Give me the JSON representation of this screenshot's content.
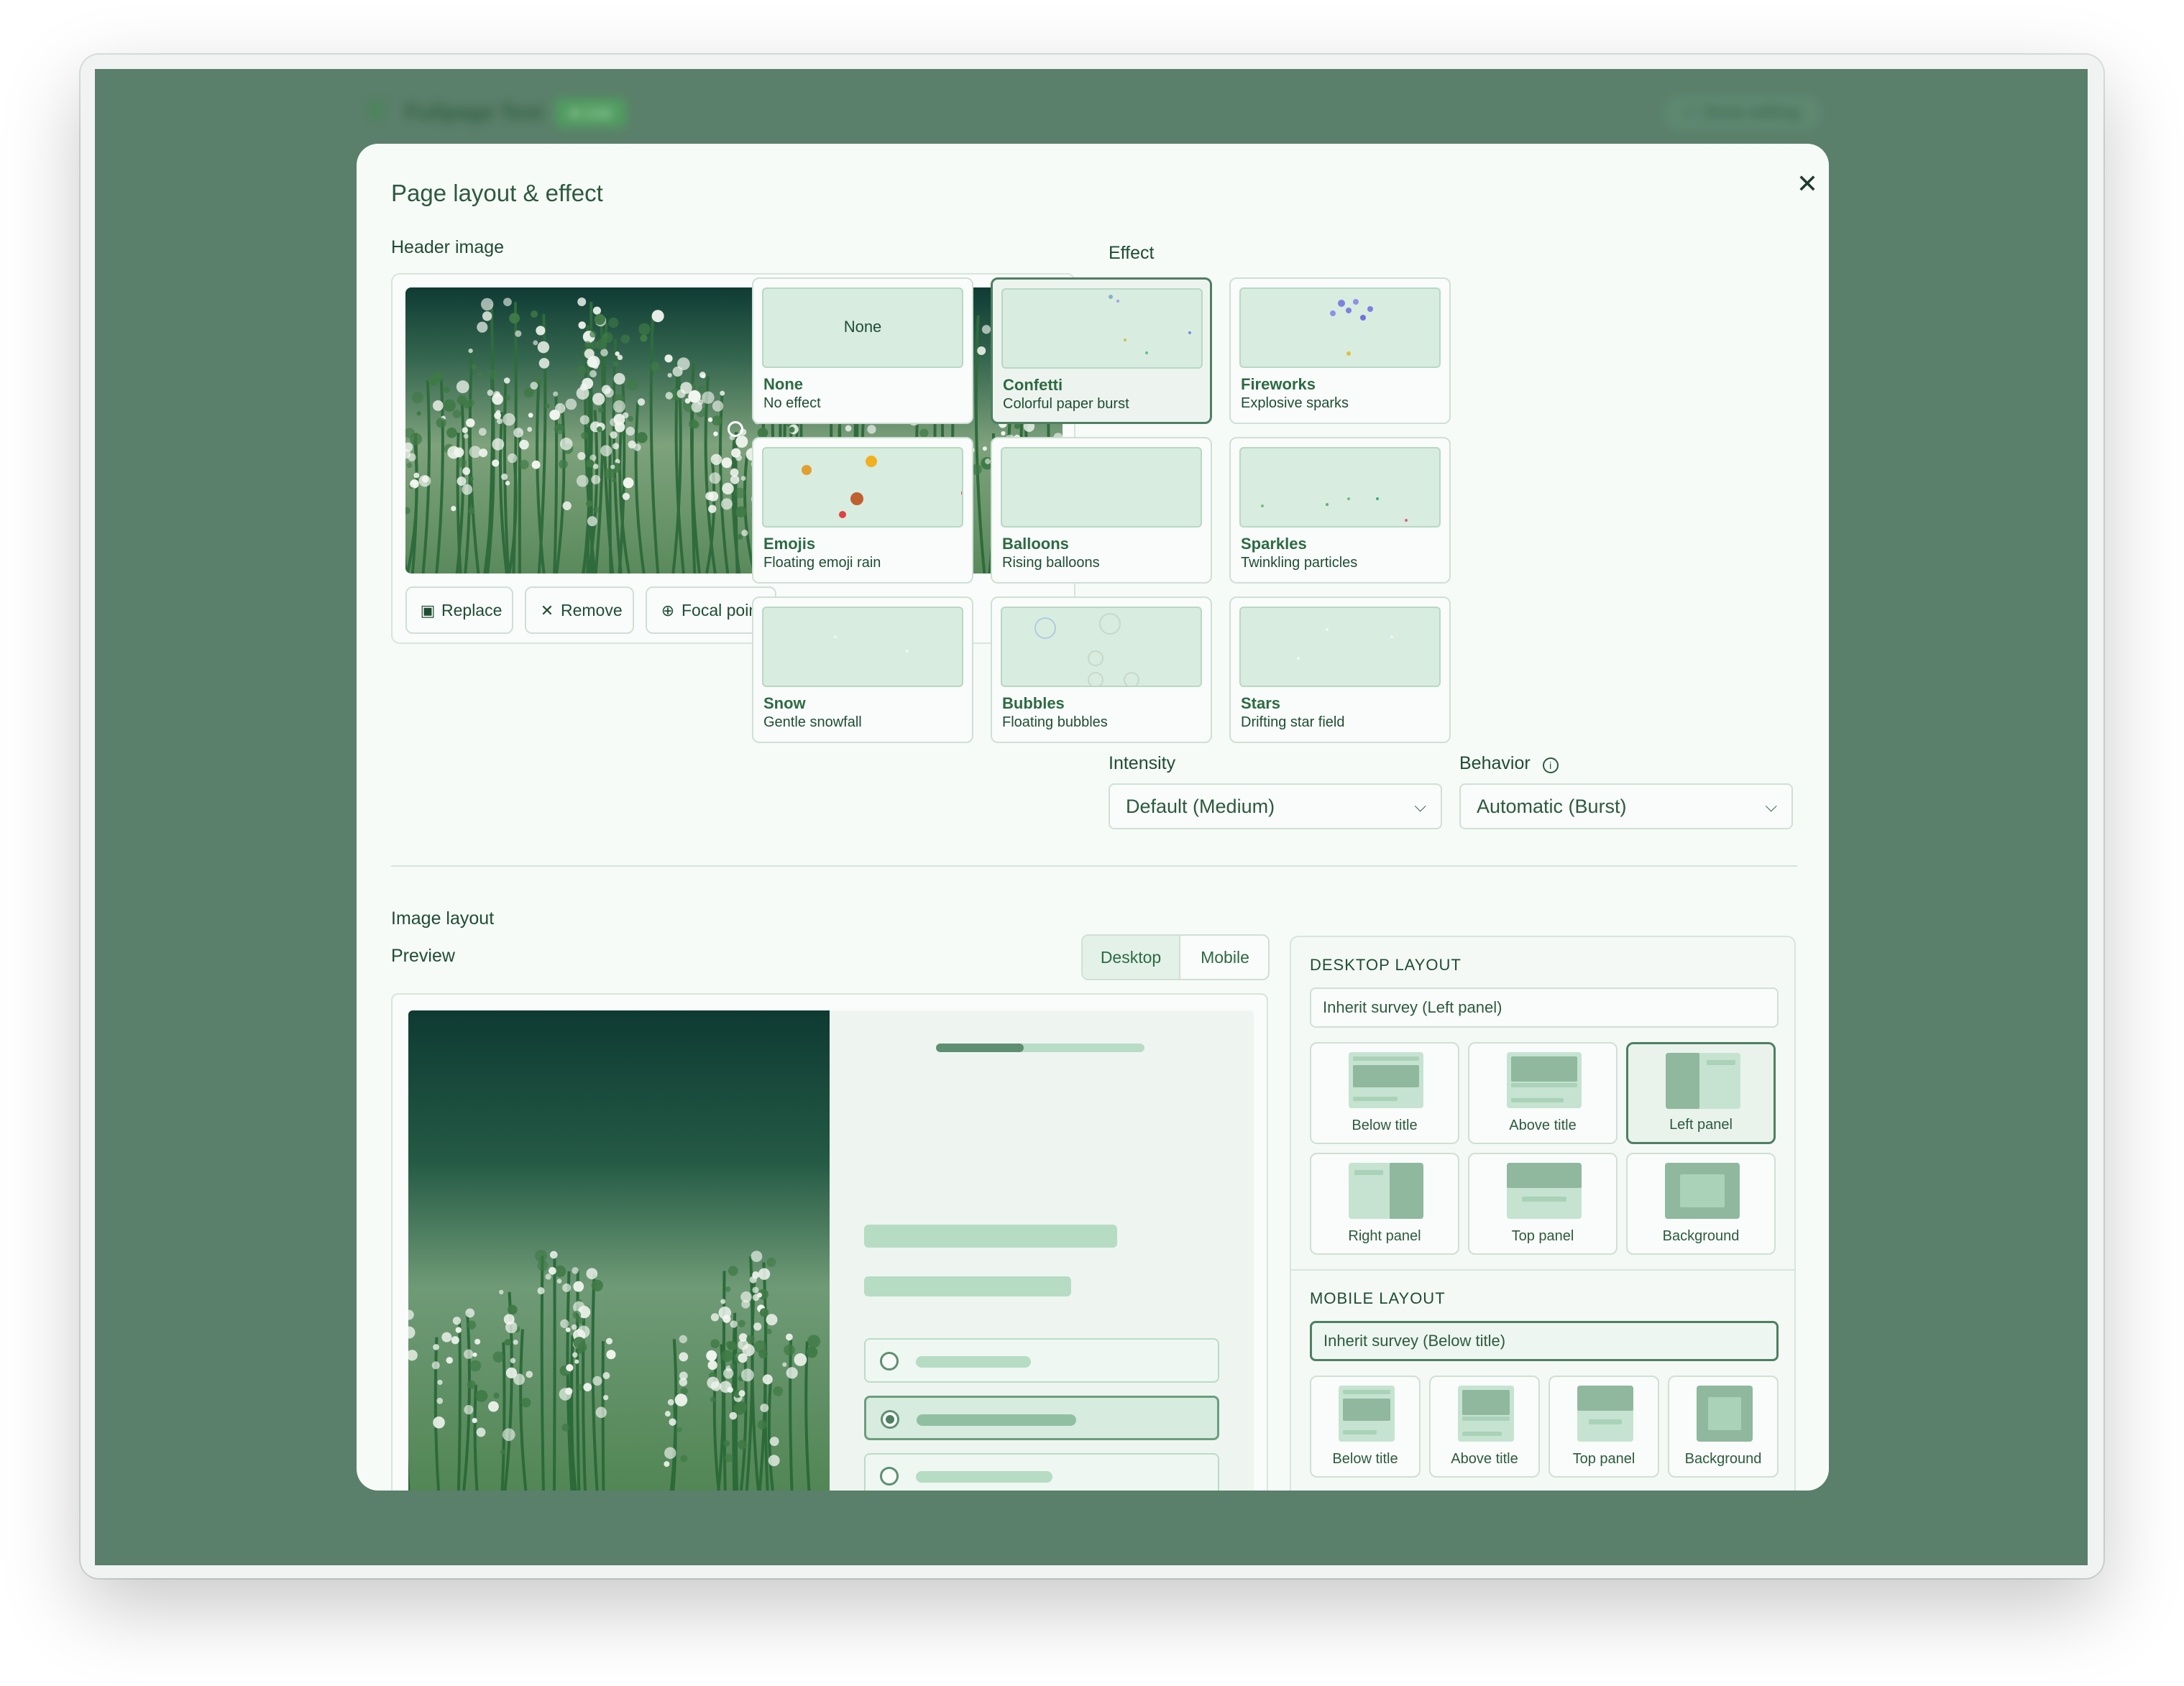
{
  "app": {
    "title": "Fullpage Test",
    "badge": "● Live",
    "done_button": "✓  Done editing"
  },
  "modal": {
    "title": "Page layout & effect",
    "close_label": "✕",
    "header_image": {
      "label": "Header image",
      "buttons": {
        "replace": "Replace",
        "remove": "Remove",
        "focal": "Focal point"
      }
    },
    "effect": {
      "label": "Effect",
      "cards": [
        {
          "name": "None",
          "desc": "No effect",
          "preview": "None",
          "selected": false
        },
        {
          "name": "Confetti",
          "desc": "Colorful paper burst",
          "selected": true
        },
        {
          "name": "Fireworks",
          "desc": "Explosive sparks",
          "selected": false
        },
        {
          "name": "Emojis",
          "desc": "Floating emoji rain",
          "selected": false
        },
        {
          "name": "Balloons",
          "desc": "Rising balloons",
          "selected": false
        },
        {
          "name": "Sparkles",
          "desc": "Twinkling particles",
          "selected": false
        },
        {
          "name": "Snow",
          "desc": "Gentle snowfall",
          "selected": false
        },
        {
          "name": "Bubbles",
          "desc": "Floating bubbles",
          "selected": false
        },
        {
          "name": "Stars",
          "desc": "Drifting star field",
          "selected": false
        }
      ]
    },
    "intensity": {
      "label": "Intensity",
      "value": "Default (Medium)"
    },
    "behavior": {
      "label": "Behavior",
      "value": "Automatic (Burst)"
    },
    "image_layout": {
      "label": "Image layout",
      "preview_label": "Preview",
      "tabs": {
        "desktop": "Desktop",
        "mobile": "Mobile",
        "active": "Desktop"
      },
      "preview": {
        "progress": 0.42,
        "selected_option": 2
      },
      "desktop": {
        "title": "DESKTOP LAYOUT",
        "inherit": "Inherit survey (Left panel)",
        "options": [
          "Below title",
          "Above title",
          "Left panel",
          "Right panel",
          "Top panel",
          "Background"
        ],
        "selected": "Left panel"
      },
      "mobile": {
        "title": "MOBILE LAYOUT",
        "inherit": "Inherit survey (Below title)",
        "options": [
          "Below title",
          "Above title",
          "Top panel",
          "Background"
        ]
      }
    }
  },
  "colors": {
    "backdrop": "#5a7f6a",
    "modal_bg": "#f7fbf8",
    "accent": "#4f7f62",
    "text": "#1f4d33"
  }
}
